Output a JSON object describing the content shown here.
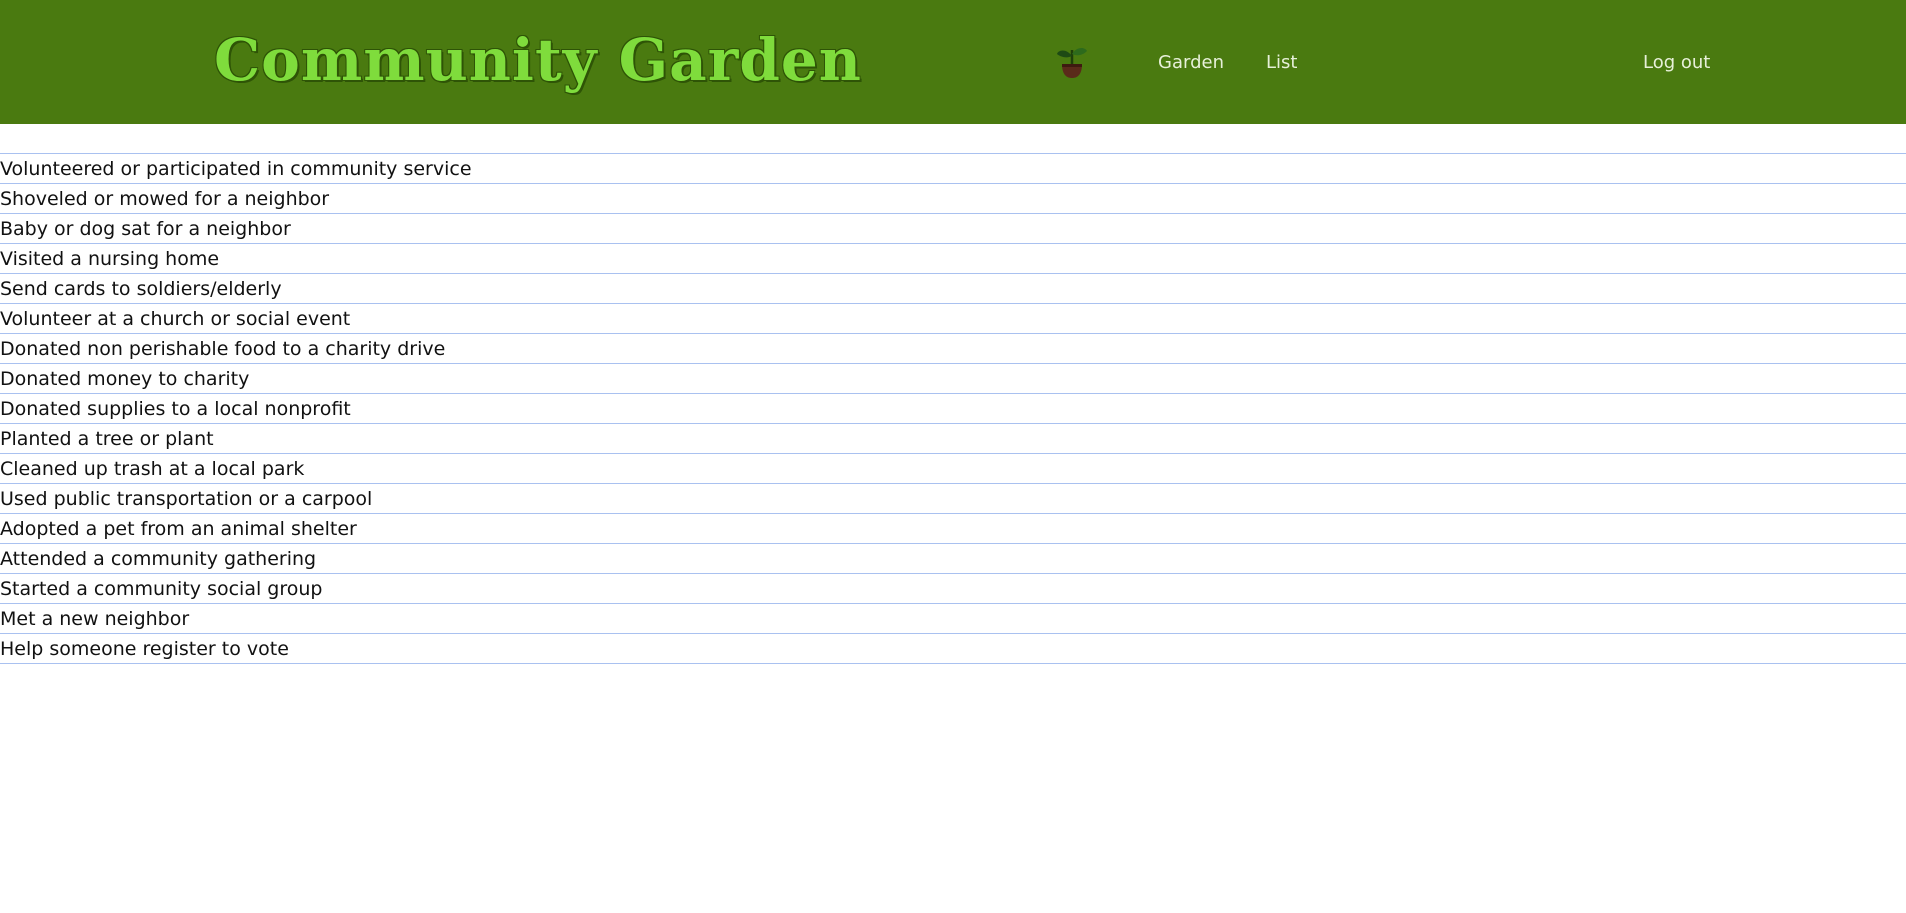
{
  "header": {
    "logo_text": "Community Garden",
    "icon": "sprout-pot-icon",
    "nav": [
      {
        "label": "Garden"
      },
      {
        "label": "List"
      }
    ],
    "logout_label": "Log out",
    "colors": {
      "header_bg": "#4a7a10",
      "logo_fill": "#7fdc3c",
      "nav_text": "#e7f0d9",
      "row_divider": "#a9c1f0"
    }
  },
  "list": {
    "items": [
      "Volunteered or participated in community service",
      "Shoveled or mowed for a neighbor",
      "Baby or dog sat for a neighbor",
      "Visited a nursing home",
      "Send cards to soldiers/elderly",
      "Volunteer at a church or social event",
      "Donated non perishable food to a charity drive",
      "Donated money to charity",
      "Donated supplies to a local nonprofit",
      "Planted a tree or plant",
      "Cleaned up trash at a local park",
      "Used public transportation or a carpool",
      "Adopted a pet from an animal shelter",
      "Attended a community gathering",
      "Started a community social group",
      "Met a new neighbor",
      "Help someone register to vote"
    ]
  }
}
